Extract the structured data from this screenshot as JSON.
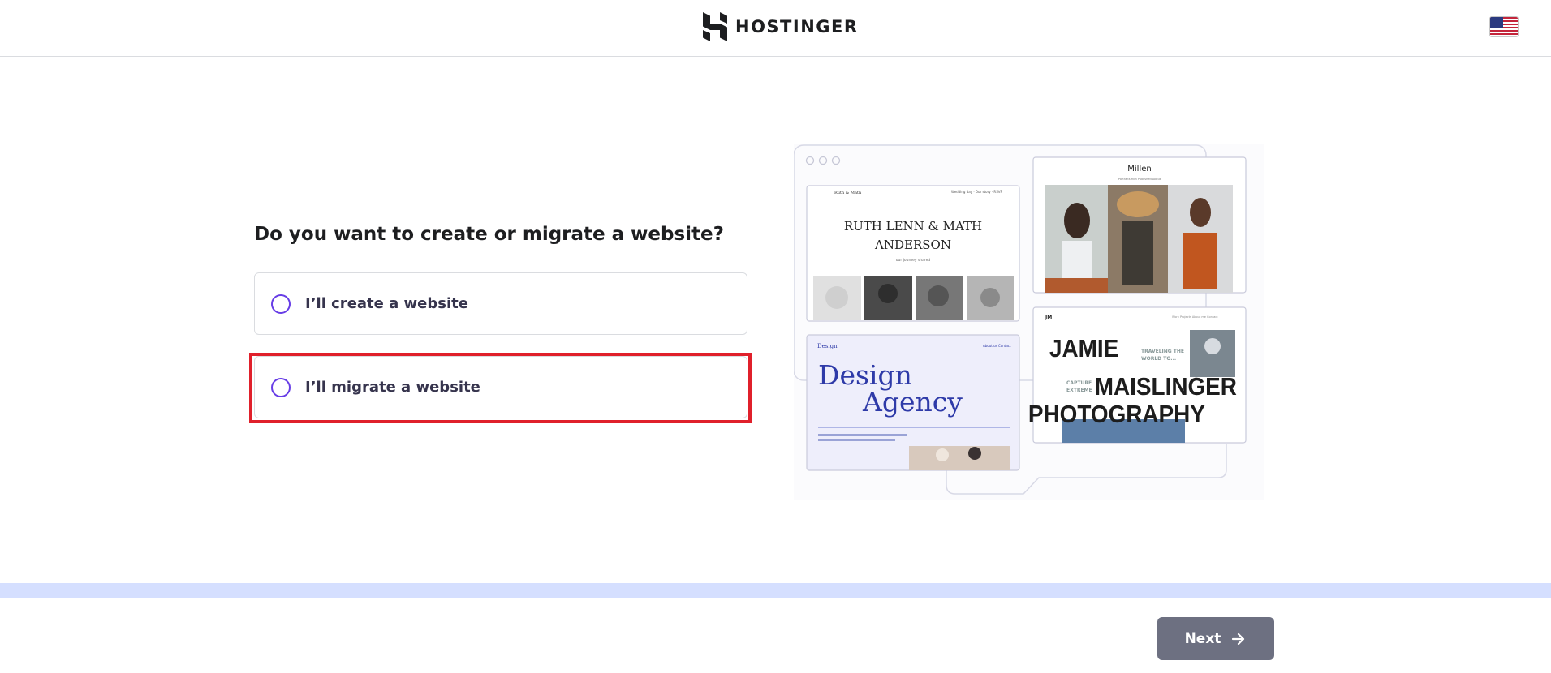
{
  "header": {
    "logo_text": "HOSTINGER",
    "language_flag": "us-flag-icon"
  },
  "main": {
    "question": "Do you want to create or migrate a website?",
    "options": [
      {
        "label": "I’ll create a website",
        "selected": false
      },
      {
        "label": "I’ll migrate a website",
        "selected": false,
        "highlighted": true
      }
    ]
  },
  "illustration": {
    "card1": {
      "brand": "Ruth & Math",
      "title_line1": "RUTH LENN & MATH",
      "title_line2": "ANDERSON",
      "subtitle": "our journey shared"
    },
    "card2": {
      "title": "Millen",
      "nav": [
        "Portraits",
        "Film",
        "Published",
        "About"
      ]
    },
    "card3": {
      "brand": "Design",
      "title_line1": "Design",
      "title_line2": "Agency",
      "nav": [
        "About us",
        "Contact"
      ]
    },
    "card4": {
      "brand": "JM",
      "line1": "JAMIE",
      "line2": "MAISLINGER",
      "line3": "PHOTOGRAPHY",
      "tag1": "TRAVELING THE WORLD TO...",
      "tag2": "CAPTURE EXTREME"
    }
  },
  "footer": {
    "next_label": "Next"
  },
  "colors": {
    "accent": "#673de6",
    "highlight": "#e0202b",
    "progress": "#d5dfff",
    "button": "#6d7081"
  }
}
